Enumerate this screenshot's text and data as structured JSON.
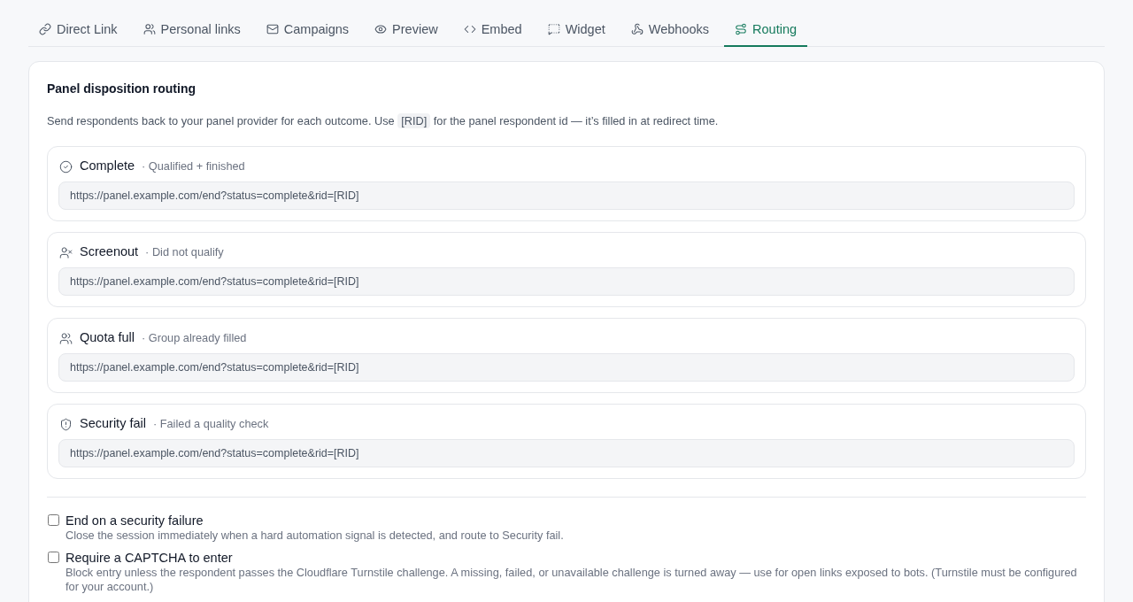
{
  "tabs": [
    {
      "label": "Direct Link",
      "selected": false
    },
    {
      "label": "Personal links",
      "selected": false
    },
    {
      "label": "Campaigns",
      "selected": false
    },
    {
      "label": "Preview",
      "selected": false
    },
    {
      "label": "Embed",
      "selected": false
    },
    {
      "label": "Widget",
      "selected": false
    },
    {
      "label": "Webhooks",
      "selected": false
    },
    {
      "label": "Routing",
      "selected": true
    }
  ],
  "routing": {
    "title": "Panel disposition routing",
    "description_before": "Send respondents back to your panel provider for each outcome. Use",
    "description_code": "[RID]",
    "description_after": "for the panel respondent id — it’s filled in at redirect time."
  },
  "outcomes": [
    {
      "title": "Complete",
      "note": "· Qualified + finished",
      "url": "https://panel.example.com/end?status=complete&rid=[RID]"
    },
    {
      "title": "Screenout",
      "note": "· Did not qualify",
      "url": "https://panel.example.com/end?status=complete&rid=[RID]"
    },
    {
      "title": "Quota full",
      "note": "· Group already filled",
      "url": "https://panel.example.com/end?status=complete&rid=[RID]"
    },
    {
      "title": "Security fail",
      "note": "· Failed a quality check",
      "url": "https://panel.example.com/end?status=complete&rid=[RID]"
    }
  ],
  "options": [
    {
      "label": "End on a security failure",
      "description": "Close the session immediately when a hard automation signal is detected, and route to Security fail.",
      "checked": false
    },
    {
      "label": "Require a CAPTCHA to enter",
      "description": "Block entry unless the respondent passes the Cloudflare Turnstile challenge. A missing, failed, or unavailable challenge is turned away — use for open links exposed to bots. (Turnstile must be configured for your account.)",
      "checked": false
    }
  ]
}
